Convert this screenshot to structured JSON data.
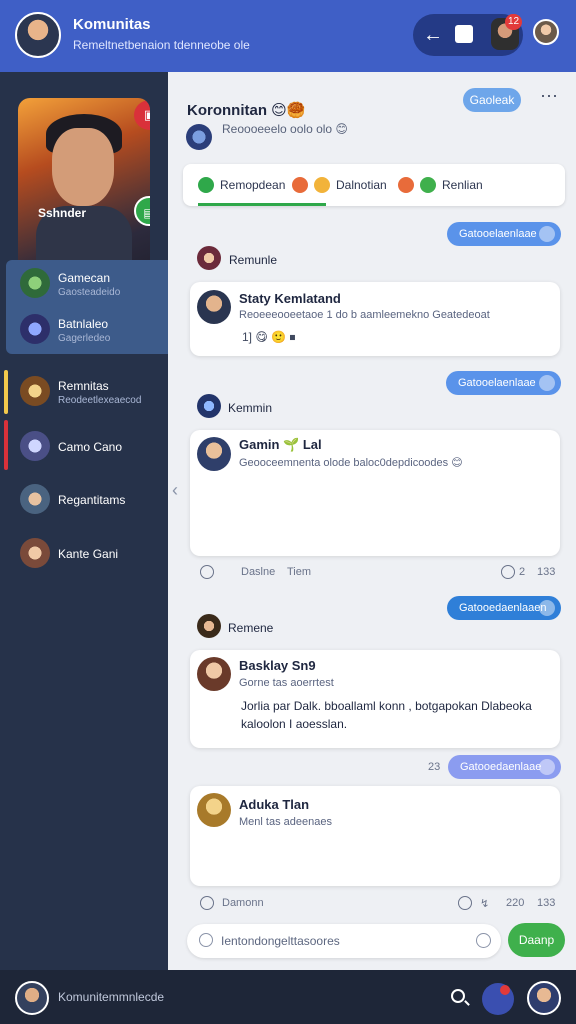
{
  "header": {
    "title": "Komunitas",
    "subtitle": "Remeltnetbenaion tdenneobe ole",
    "badge_count": "12"
  },
  "sidebar": {
    "featured_label": "Sshnder",
    "items": [
      {
        "name": "Gamecan",
        "sub": "Gaosteadeido"
      },
      {
        "name": "Batnlaleo",
        "sub": "Gagerledeo"
      },
      {
        "name": "Remnitas",
        "sub": "Reodeetlexeaecod"
      },
      {
        "name": "Camo Cano",
        "sub": ""
      },
      {
        "name": "Regantitams",
        "sub": ""
      },
      {
        "name": "Kante Gani",
        "sub": ""
      }
    ]
  },
  "main": {
    "title": "Koronnitan 😊🥮",
    "subtitle": "Reoooeeelo oolo olo 😊",
    "top_button": "Gaoleak",
    "tabs": [
      "Remopdean",
      "Dalnotian",
      "Renlian"
    ],
    "pill_1": "Gatooelaenlaae",
    "pill_2": "Gatooelaenlaae",
    "pill_3": "Gatooedaenlaaen",
    "pill_4": "Gatooedaenlaae",
    "pill_4_prefix": "23",
    "section_1": "Remunle",
    "section_2": "Kemmin",
    "section_3": "Remene",
    "card_1": {
      "name": "Staty Kemlatand",
      "text": "Reoeeeooeetaoe 1 do b aamleemekno Geatedeoat",
      "reactions": "1] 😋 🙂 ⏹"
    },
    "card_2": {
      "name": "Gamin 🌱 Lal",
      "text": "Geooceemnenta olode baloc0depdicoodes 😊"
    },
    "meta_1": {
      "a": "Daslne",
      "b": "Tiem",
      "c": "2",
      "d": "133"
    },
    "card_3": {
      "name": "Basklay Sn9",
      "text": "Gorne tas aoerrtest",
      "body": "Jorlia par Dalk. bboallaml konn , botgapokan Dlabeoka kaloolon I aoesslan."
    },
    "card_4": {
      "name": "Aduka Tlan",
      "text": "Menl tas adeenaes"
    },
    "meta_2": {
      "a": "Damonn",
      "c": "220",
      "d": "133"
    },
    "input_placeholder": "Ientondongelttasoores",
    "send_label": "Daanp"
  },
  "bottom": {
    "text": "Komunitemmnlecde"
  },
  "colors": {
    "header_bg": "#3f5fc6",
    "sidebar_bg": "#26324a",
    "accent_blue": "#5a93ea",
    "accent_green": "#3fb04c",
    "badge_red": "#e23a3a"
  }
}
